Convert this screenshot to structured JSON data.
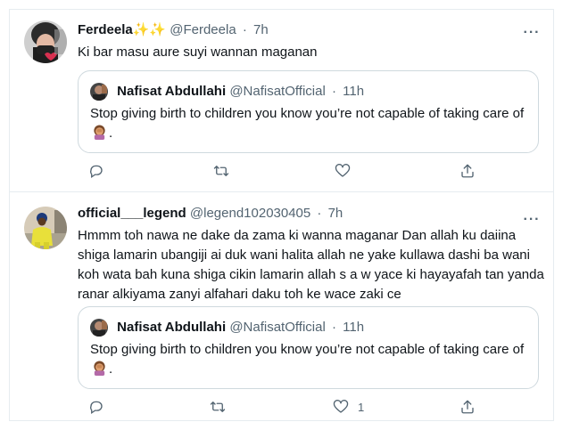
{
  "tweets": [
    {
      "name": "Ferdeela✨✨",
      "handle": "@Ferdeela",
      "time": "7h",
      "text": "Ki bar masu aure suyi wannan maganan",
      "quote": {
        "name": "Nafisat Abdullahi",
        "handle": "@NafisatOfficial",
        "time": "11h",
        "text": "Stop giving birth to children you know you’re not capable of taking care of",
        "emoji": "woman-facepalming"
      },
      "actions": {
        "reply": "",
        "retweet": "",
        "like": "",
        "share": ""
      }
    },
    {
      "name": "official___legend",
      "handle": "@legend102030405",
      "time": "7h",
      "text": "Hmmm toh nawa ne dake da zama ki wanna maganar Dan allah ku daiina shiga lamarin ubangiji ai duk wani halita allah ne yake kullawa dashi ba wani koh wata bah kuna shiga cikin lamarin allah  s a w yace ki hayayafah tan yanda ranar alkiyama zanyi alfahari daku toh ke wace zaki ce",
      "quote": {
        "name": "Nafisat Abdullahi",
        "handle": "@NafisatOfficial",
        "time": "11h",
        "text": "Stop giving birth to children you know you’re not capable of taking care of",
        "emoji": "woman-facepalming"
      },
      "actions": {
        "reply": "",
        "retweet": "",
        "like": "1",
        "share": ""
      }
    }
  ],
  "dot": "·",
  "more_glyph": "···",
  "period": ".",
  "colors": {
    "secondary_text": "#536471",
    "border": "#e6ecf0",
    "quote_border": "#cfd9de"
  }
}
